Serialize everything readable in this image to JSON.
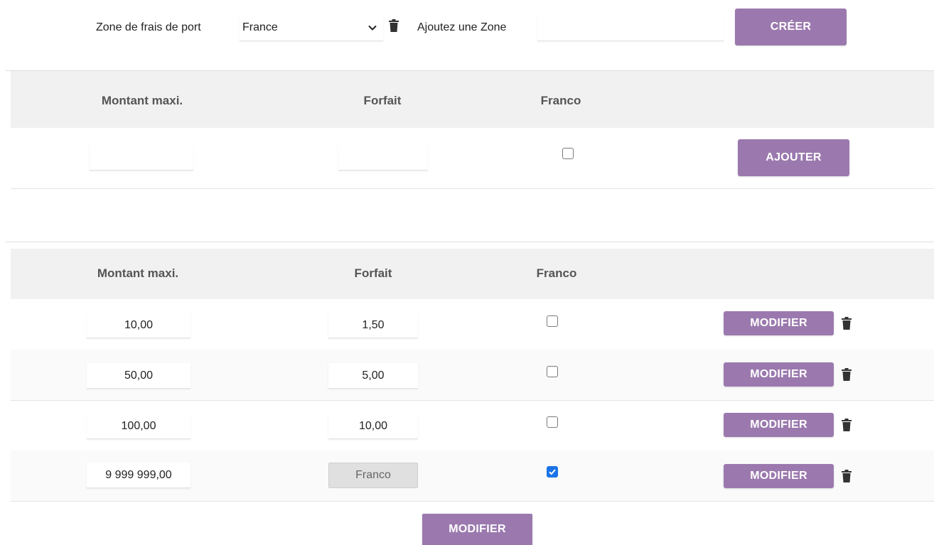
{
  "topbar": {
    "zone_label": "Zone de frais de port",
    "zone_selected": "France",
    "add_zone_label": "Ajoutez une Zone",
    "add_zone_value": "",
    "create_button": "CRÉER"
  },
  "add_table": {
    "headers": [
      "Montant maxi.",
      "Forfait",
      "Franco"
    ],
    "row": {
      "montant": "",
      "forfait": "",
      "franco": false
    },
    "add_button": "AJOUTER"
  },
  "list_table": {
    "headers": [
      "Montant maxi.",
      "Forfait",
      "Franco"
    ],
    "rows": [
      {
        "montant": "10,00",
        "forfait": "1,50",
        "franco": false,
        "button": "MODIFIER"
      },
      {
        "montant": "50,00",
        "forfait": "5,00",
        "franco": false,
        "button": "MODIFIER"
      },
      {
        "montant": "100,00",
        "forfait": "10,00",
        "franco": false,
        "button": "MODIFIER"
      },
      {
        "montant": "9 999 999,00",
        "forfait": "Franco",
        "franco": true,
        "forfait_disabled": true,
        "button": "MODIFIER"
      }
    ],
    "modify_all_button": "MODIFIER"
  },
  "colors": {
    "accent": "#9b79ae",
    "header_bg": "#f1f1f1",
    "checkbox_checked": "#1a73e8"
  },
  "icons": {
    "delete": "trash-icon",
    "dropdown": "chevron-down-icon",
    "check": "check-icon"
  }
}
